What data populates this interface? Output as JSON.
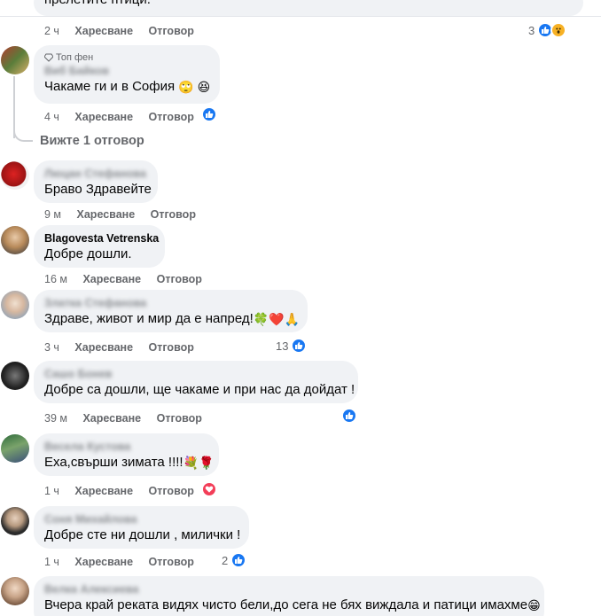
{
  "ui": {
    "like_label": "Харесване",
    "reply_label": "Отговор"
  },
  "top_partial": {
    "text": "прелетите птици.",
    "time": "2 ч",
    "reactions": "3"
  },
  "view_replies": "Вижте 1 отговор",
  "comments": [
    {
      "author": "Виб Байков",
      "badge": "Топ фен",
      "text": "Чакаме ги и в София",
      "emoji": "🙄 😆",
      "time": "4 ч"
    },
    {
      "author": "Люцан Стефанова",
      "text": "Браво Здравейте",
      "time": "9 м"
    },
    {
      "author": "Blagovesta Vetrenska",
      "text": "Добре дошли.",
      "time": "16 м"
    },
    {
      "author": "Златка Стефанова",
      "text": "Здраве, живот и мир да е напред!",
      "emoji": "🍀❤️🙏",
      "time": "3 ч",
      "reactions": "13"
    },
    {
      "author": "Сашо Бонев",
      "text": "Добре са дошли, ще чакаме и при нас да дойдат !",
      "time": "39 м"
    },
    {
      "author": "Весела Кустова",
      "text": "Еха,свърши зимата !!!!",
      "emoji": "💐🌹",
      "time": "1 ч"
    },
    {
      "author": "Соня Михайлова",
      "text": "Добре сте ни дошли , милички !",
      "time": "1 ч",
      "reactions": "2"
    },
    {
      "author": "Велка Алексиева",
      "text": "Вчера край реката видях чисто бели,до сега не бях виждала и патици имахме",
      "emoji": "😁"
    }
  ]
}
